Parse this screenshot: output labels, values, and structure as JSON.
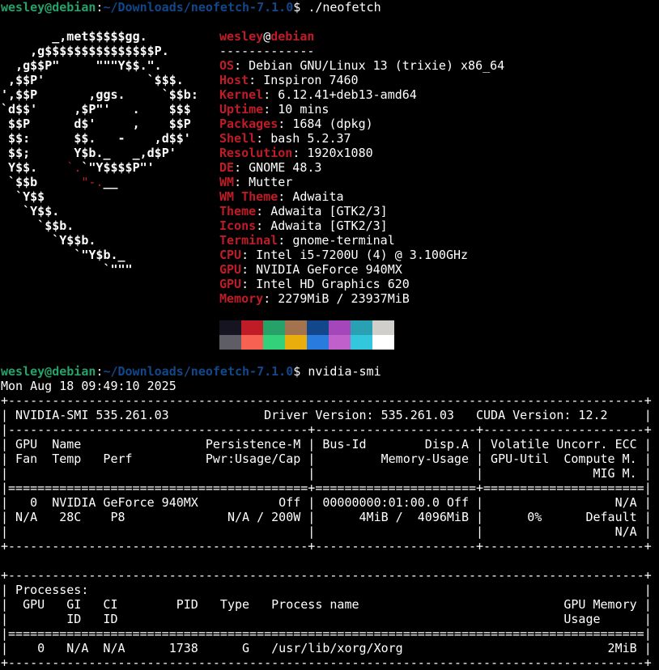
{
  "prompt1": {
    "user": "wesley@debian",
    "path": "~/Downloads/neofetch-7.1.0",
    "symbol": "$ ",
    "command": "./neofetch"
  },
  "neofetch": {
    "logo_lines": [
      "       _,met$$$$$gg.",
      "    ,g$$$$$$$$$$$$$$$P.",
      "  ,g$$P\"     \"\"\"Y$$.\".",
      " ,$$P'              `$$$.",
      "',$$P       ,ggs.     `$$b:",
      "`d$$'     ,$P\"'   .    $$$",
      " $$P      d$'     ,    $$P",
      " $$:      $$.   -    ,d$$'",
      " $$;      Y$b._   _,d$P'",
      " Y$$.    `.`\"Y$$$$P\"'",
      " `$$b      \"-.__",
      "  `Y$$",
      "   `Y$$.",
      "     `$$b.",
      "       `Y$$b.",
      "          `\"Y$b._",
      "              `\"\"\""
    ],
    "header_user": "wesley",
    "header_at": "@",
    "header_host": "debian",
    "separator": "-------------",
    "fields": [
      {
        "key": "OS",
        "value": "Debian GNU/Linux 13 (trixie) x86_64"
      },
      {
        "key": "Host",
        "value": "Inspiron 7460"
      },
      {
        "key": "Kernel",
        "value": "6.12.41+deb13-amd64"
      },
      {
        "key": "Uptime",
        "value": "10 mins"
      },
      {
        "key": "Packages",
        "value": "1684 (dpkg)"
      },
      {
        "key": "Shell",
        "value": "bash 5.2.37"
      },
      {
        "key": "Resolution",
        "value": "1920x1080"
      },
      {
        "key": "DE",
        "value": "GNOME 48.3"
      },
      {
        "key": "WM",
        "value": "Mutter"
      },
      {
        "key": "WM Theme",
        "value": "Adwaita"
      },
      {
        "key": "Theme",
        "value": "Adwaita [GTK2/3]"
      },
      {
        "key": "Icons",
        "value": "Adwaita [GTK2/3]"
      },
      {
        "key": "Terminal",
        "value": "gnome-terminal"
      },
      {
        "key": "CPU",
        "value": "Intel i5-7200U (4) @ 3.100GHz"
      },
      {
        "key": "GPU",
        "value": "NVIDIA GeForce 940MX"
      },
      {
        "key": "GPU",
        "value": "Intel HD Graphics 620"
      },
      {
        "key": "Memory",
        "value": "2279MiB / 23937MiB"
      }
    ],
    "palette_top": [
      "#171421",
      "#c01c28",
      "#26a269",
      "#a2734c",
      "#12488b",
      "#a347ba",
      "#2aa1b3",
      "#d0cfcc"
    ],
    "palette_bottom": [
      "#5e5c64",
      "#f66151",
      "#33d17a",
      "#e9ad0c",
      "#2a7bde",
      "#c061cb",
      "#33c7de",
      "#ffffff"
    ]
  },
  "prompt2": {
    "user": "wesley@debian",
    "path": "~/Downloads/neofetch-7.1.0",
    "symbol": "$ ",
    "command": "nvidia-smi"
  },
  "smi": {
    "lines": [
      "Mon Aug 18 09:49:10 2025",
      "+---------------------------------------------------------------------------------------+",
      "| NVIDIA-SMI 535.261.03             Driver Version: 535.261.03   CUDA Version: 12.2     |",
      "|-----------------------------------------+----------------------+----------------------+",
      "| GPU  Name                 Persistence-M | Bus-Id        Disp.A | Volatile Uncorr. ECC |",
      "| Fan  Temp   Perf          Pwr:Usage/Cap |         Memory-Usage | GPU-Util  Compute M. |",
      "|                                         |                      |               MIG M. |",
      "|=========================================+======================+======================|",
      "|   0  NVIDIA GeForce 940MX           Off | 00000000:01:00.0 Off |                  N/A |",
      "| N/A   28C    P8              N/A / 200W |      4MiB /  4096MiB |      0%      Default |",
      "|                                         |                      |                  N/A |",
      "+-----------------------------------------+----------------------+----------------------+",
      "",
      "+---------------------------------------------------------------------------------------+",
      "| Processes:                                                                            |",
      "|  GPU   GI   CI        PID   Type   Process name                            GPU Memory |",
      "|        ID   ID                                                             Usage      |",
      "|=======================================================================================|",
      "|    0   N/A  N/A      1738      G   /usr/lib/xorg/Xorg                            2MiB |",
      "+---------------------------------------------------------------------------------------+"
    ]
  }
}
